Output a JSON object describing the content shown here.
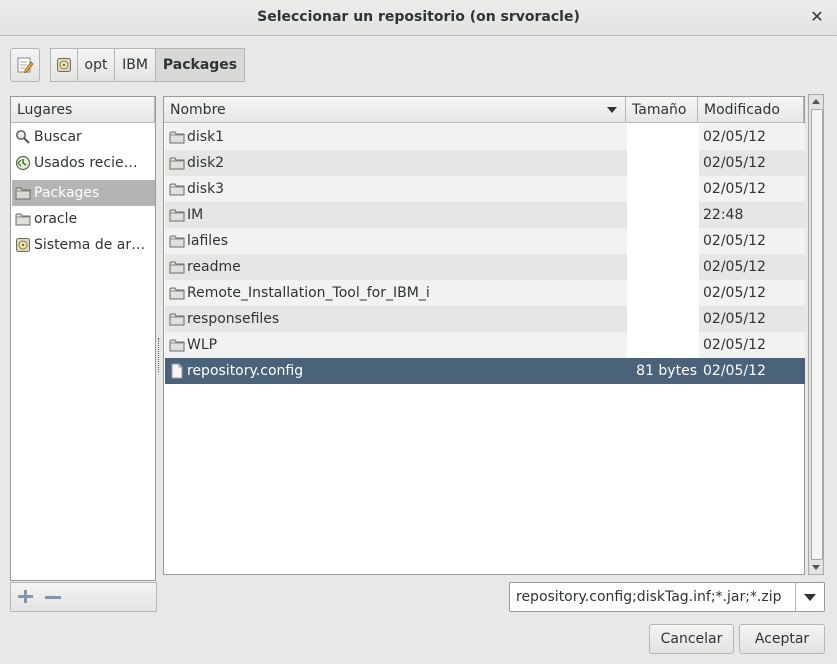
{
  "window": {
    "title": "Seleccionar un repositorio (on srvoracle)",
    "close_symbol": "✕"
  },
  "breadcrumbs": {
    "items": [
      "opt",
      "IBM",
      "Packages"
    ],
    "active": "Packages"
  },
  "places": {
    "header": "Lugares",
    "items": [
      {
        "label": "Buscar",
        "icon": "search-icon"
      },
      {
        "label": "Usados recie…",
        "icon": "recent-icon"
      },
      {
        "label": "Packages",
        "icon": "folder-icon",
        "selected": true
      },
      {
        "label": "oracle",
        "icon": "folder-icon"
      },
      {
        "label": "Sistema de ar…",
        "icon": "filesystem-icon"
      }
    ]
  },
  "files": {
    "columns": {
      "name": "Nombre",
      "size": "Tamaño",
      "modified": "Modificado"
    },
    "rows": [
      {
        "name": "disk1",
        "size": "",
        "modified": "02/05/12",
        "type": "folder"
      },
      {
        "name": "disk2",
        "size": "",
        "modified": "02/05/12",
        "type": "folder"
      },
      {
        "name": "disk3",
        "size": "",
        "modified": "02/05/12",
        "type": "folder"
      },
      {
        "name": "IM",
        "size": "",
        "modified": "22:48",
        "type": "folder"
      },
      {
        "name": "lafiles",
        "size": "",
        "modified": "02/05/12",
        "type": "folder"
      },
      {
        "name": "readme",
        "size": "",
        "modified": "02/05/12",
        "type": "folder"
      },
      {
        "name": "Remote_Installation_Tool_for_IBM_i",
        "size": "",
        "modified": "02/05/12",
        "type": "folder"
      },
      {
        "name": "responsefiles",
        "size": "",
        "modified": "02/05/12",
        "type": "folder"
      },
      {
        "name": "WLP",
        "size": "",
        "modified": "02/05/12",
        "type": "folder"
      },
      {
        "name": "repository.config",
        "size": "81 bytes",
        "modified": "02/05/12",
        "type": "file",
        "selected": true
      }
    ]
  },
  "filter": {
    "value": "repository.config;diskTag.inf;*.jar;*.zip"
  },
  "buttons": {
    "cancel": "Cancelar",
    "accept": "Aceptar"
  },
  "colors": {
    "selection": "#4a637a",
    "place_selection": "#b4b4b2",
    "background": "#e8e8e7"
  }
}
